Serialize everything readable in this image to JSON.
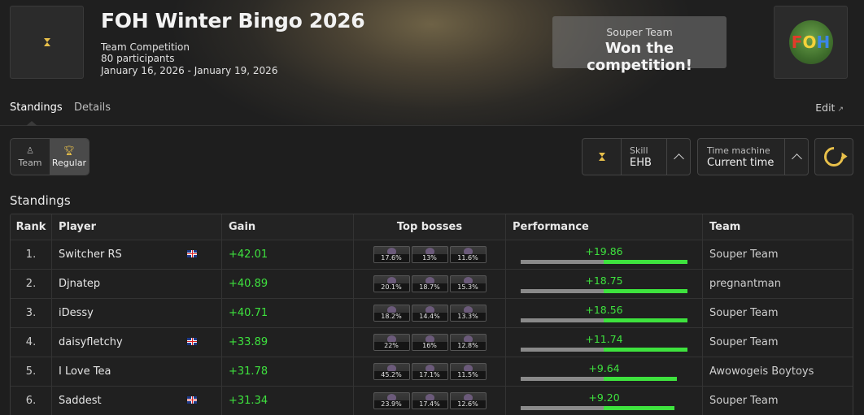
{
  "competition": {
    "title": "FOH Winter Bingo 2026",
    "type": "Team Competition",
    "participants": "80 participants",
    "dates": "January 16, 2026 - January 19, 2026"
  },
  "winner": {
    "team": "Souper Team",
    "text": "Won the competition!"
  },
  "logo_text": [
    "F",
    "O",
    "H"
  ],
  "tabs": [
    {
      "label": "Standings",
      "active": true
    },
    {
      "label": "Details",
      "active": false
    }
  ],
  "edit_label": "Edit",
  "view_toggle": [
    {
      "label": "Team",
      "selected": false
    },
    {
      "label": "Regular",
      "selected": true
    }
  ],
  "skill_select": {
    "label": "Skill",
    "value": "EHB"
  },
  "time_machine": {
    "label": "Time machine",
    "value": "Current time"
  },
  "section_title": "Standings",
  "table": {
    "headers": {
      "rank": "Rank",
      "player": "Player",
      "gain": "Gain",
      "bosses": "Top bosses",
      "performance": "Performance",
      "team": "Team"
    },
    "rows": [
      {
        "rank": "1.",
        "player": "Switcher RS",
        "flag": true,
        "gain": "+42.01",
        "bosses": [
          "17.6%",
          "13%",
          "11.6%"
        ],
        "perf": "+19.86",
        "perf_frac": 1.0,
        "team": "Souper Team"
      },
      {
        "rank": "2.",
        "player": "Djnatep",
        "flag": false,
        "gain": "+40.89",
        "bosses": [
          "20.1%",
          "18.7%",
          "15.3%"
        ],
        "perf": "+18.75",
        "perf_frac": 1.0,
        "team": "pregnantman"
      },
      {
        "rank": "3.",
        "player": "iDessy",
        "flag": false,
        "gain": "+40.71",
        "bosses": [
          "18.2%",
          "14.4%",
          "13.3%"
        ],
        "perf": "+18.56",
        "perf_frac": 1.0,
        "team": "Souper Team"
      },
      {
        "rank": "4.",
        "player": "daisyfletchy",
        "flag": true,
        "gain": "+33.89",
        "bosses": [
          "22%",
          "16%",
          "12.8%"
        ],
        "perf": "+11.74",
        "perf_frac": 1.0,
        "team": "Souper Team"
      },
      {
        "rank": "5.",
        "player": "I Love Tea",
        "flag": false,
        "gain": "+31.78",
        "bosses": [
          "45.2%",
          "17.1%",
          "11.5%"
        ],
        "perf": "+9.64",
        "perf_frac": 0.87,
        "team": "Awowogeis Boytoys"
      },
      {
        "rank": "6.",
        "player": "Saddest",
        "flag": true,
        "gain": "+31.34",
        "bosses": [
          "23.9%",
          "17.4%",
          "12.6%"
        ],
        "perf": "+9.20",
        "perf_frac": 0.84,
        "team": "Souper Team"
      }
    ]
  }
}
